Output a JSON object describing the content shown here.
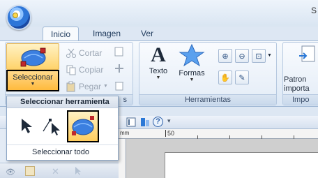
{
  "window": {
    "title_fragment": "S"
  },
  "tabs": [
    {
      "label": "Inicio",
      "active": true
    },
    {
      "label": "Imagen",
      "active": false
    },
    {
      "label": "Ver",
      "active": false
    }
  ],
  "ribbon": {
    "select_button": {
      "label": "Seleccionar"
    },
    "clipboard": {
      "cut": "Cortar",
      "copy": "Copiar",
      "paste": "Pegar",
      "group_label_fragment": "s"
    },
    "tools": {
      "text_label": "Texto",
      "shapes_label": "Formas",
      "group_label": "Herramientas"
    },
    "import": {
      "label_line1": "Patron",
      "label_line2": "importa",
      "group_label_fragment": "Impo"
    }
  },
  "dropdown": {
    "header": "Seleccionar herramienta",
    "tools": [
      "select-arrow",
      "point-edit",
      "lasso-select"
    ],
    "select_all": "Seleccionar todo"
  },
  "quickbar": {
    "help_icon": "?"
  },
  "ruler": {
    "unit": "mm",
    "tick_50": "50"
  },
  "colors": {
    "accent": "#ffba3d",
    "ribbon_border": "#9fb7d4",
    "selection_outline": "#000000"
  }
}
